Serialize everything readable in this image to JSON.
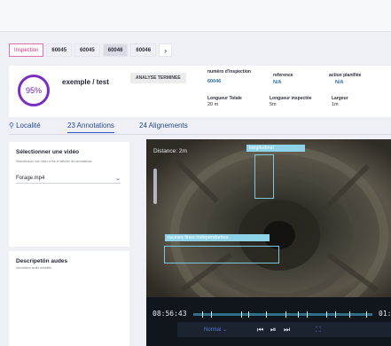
{
  "tabs": [
    {
      "label": "Inspection"
    },
    {
      "label": "60045"
    },
    {
      "label": "60045"
    },
    {
      "label": "60046"
    },
    {
      "label": "60046"
    }
  ],
  "tabs_next_icon": "chevron-right-icon",
  "summary": {
    "score": "95%",
    "title": "exemple / test",
    "status": "ANALYSE TERMINEE",
    "fields": {
      "inspection_number_label": "numéro d'inspection",
      "inspection_number": "60046",
      "reference_label": "reference",
      "reference": "N/A",
      "action_label": "action planifiée",
      "action": "N/A",
      "total_length_label": "Longueur Totale",
      "total_length": "20 m",
      "inspected_length_label": "Longueur inspectée",
      "inspected_length": "5m",
      "width_label": "Largeur",
      "width": "1m"
    }
  },
  "nav": {
    "localite": "Localité",
    "annotations": "23 Annotations",
    "alignements": "24 Alignements"
  },
  "left": {
    "video_title": "Sélectionner une vidéo",
    "video_sub": "Sélectionnez une vidéo à lire et afficher les annotations",
    "selected_video": "Forage.mp4",
    "desc_title": "Descripetön audes",
    "desc_sub": "Annotation audio détaillée"
  },
  "video": {
    "distance": "Distance: 2m",
    "annotation_1": "longitudinal",
    "annotation_2": "racines fines indépendantes",
    "current_time": "08:56:43",
    "end_time": "01:2",
    "speed": "Normal"
  },
  "colors": {
    "accent": "#7a2fc2",
    "inspection_tab": "#e06fb2",
    "annotation": "#8fd3e8"
  }
}
